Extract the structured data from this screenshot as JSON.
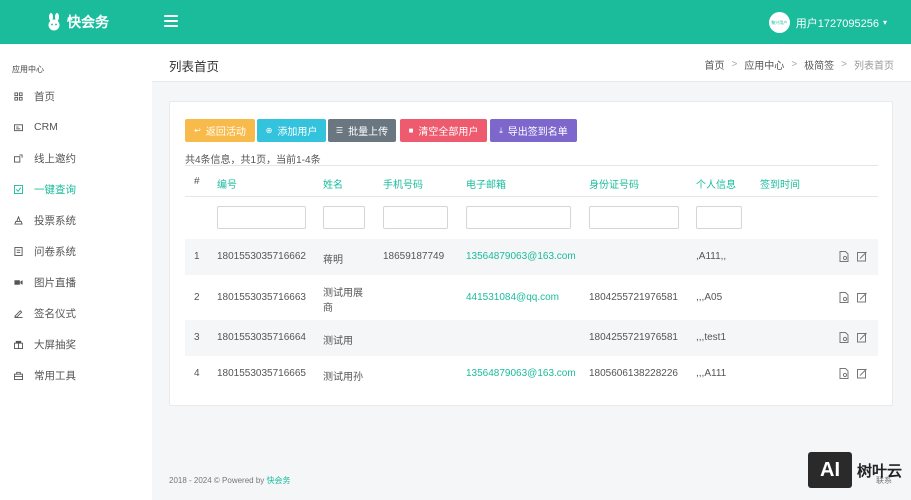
{
  "app": {
    "name": "快会务"
  },
  "user": {
    "name": "用户1727095256",
    "avatar_text": "聚兴用户"
  },
  "sidebar": {
    "section_title": "应用中心",
    "items": [
      {
        "label": "首页",
        "icon": "home-grid-icon"
      },
      {
        "label": "CRM",
        "icon": "id-card-icon"
      },
      {
        "label": "线上邀约",
        "icon": "invite-icon"
      },
      {
        "label": "一键查询",
        "icon": "checkbox-icon",
        "active": true
      },
      {
        "label": "投票系统",
        "icon": "vote-icon"
      },
      {
        "label": "问卷系统",
        "icon": "survey-icon"
      },
      {
        "label": "图片直播",
        "icon": "camera-icon"
      },
      {
        "label": "签名仪式",
        "icon": "signature-icon"
      },
      {
        "label": "大屏抽奖",
        "icon": "prize-icon"
      },
      {
        "label": "常用工具",
        "icon": "toolbox-icon"
      }
    ]
  },
  "header": {
    "title": "列表首页",
    "breadcrumb": [
      "首页",
      "应用中心",
      "极简签",
      "列表首页"
    ],
    "separator": ">"
  },
  "toolbar": {
    "back": "返回活动",
    "add_user": "添加用户",
    "batch_upload": "批量上传",
    "clear_all": "清空全部用户",
    "export": "导出签到名单"
  },
  "summary": "共4条信息，共1页，当前1-4条",
  "table": {
    "columns": [
      "#",
      "编号",
      "姓名",
      "手机号码",
      "电子邮箱",
      "身份证号码",
      "个人信息",
      "签到时间"
    ],
    "rows": [
      {
        "idx": "1",
        "id": "1801553035716662",
        "name": "蒋明",
        "phone": "18659187749",
        "email": "13564879063@163.com",
        "idcard": "",
        "info": ",A111,,",
        "time": ""
      },
      {
        "idx": "2",
        "id": "1801553035716663",
        "name_line1": "测试用展",
        "name_line2": "商",
        "phone": "",
        "email": "441531084@qq.com",
        "idcard": "1804255721976581",
        "info": ",,,A05",
        "time": ""
      },
      {
        "idx": "3",
        "id": "1801553035716664",
        "name": "测试用",
        "phone": "",
        "email": "",
        "idcard": "1804255721976581",
        "info": ",,,test1",
        "time": ""
      },
      {
        "idx": "4",
        "id": "1801553035716665",
        "name": "测试用孙",
        "phone": "",
        "email": "13564879063@163.com",
        "idcard": "1805606138228226",
        "info": ",,,A111",
        "time": ""
      }
    ]
  },
  "footer": {
    "text": "2018 - 2024 © Powered by ",
    "brand": "快会务",
    "tail": "联系"
  },
  "watermark": {
    "box": "AI",
    "text": "树叶云"
  },
  "colors": {
    "accent": "#1abc9c",
    "back": "#f8bb4b",
    "add": "#34c3dd",
    "upload": "#6a7780",
    "clear": "#ee5a6e",
    "export": "#7d67cc"
  }
}
